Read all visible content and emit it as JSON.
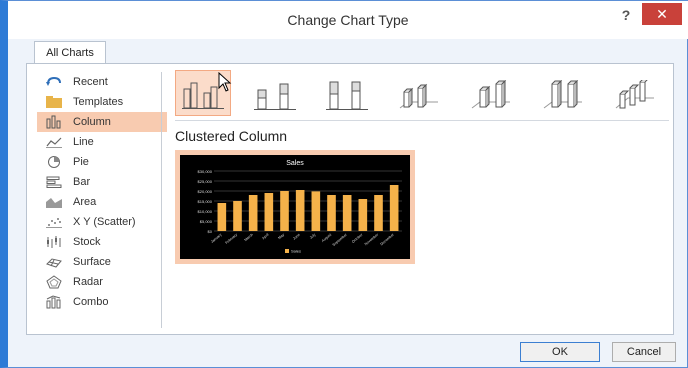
{
  "dialog": {
    "title": "Change Chart Type",
    "help_label": "?",
    "close_label": "✕"
  },
  "tabs": [
    {
      "label": "All Charts",
      "selected": true
    }
  ],
  "sidebar": {
    "items": [
      {
        "label": "Recent",
        "icon": "recent-icon"
      },
      {
        "label": "Templates",
        "icon": "folder-icon"
      },
      {
        "label": "Column",
        "icon": "column-chart-icon",
        "selected": true
      },
      {
        "label": "Line",
        "icon": "line-chart-icon"
      },
      {
        "label": "Pie",
        "icon": "pie-chart-icon"
      },
      {
        "label": "Bar",
        "icon": "bar-chart-icon"
      },
      {
        "label": "Area",
        "icon": "area-chart-icon"
      },
      {
        "label": "X Y (Scatter)",
        "icon": "scatter-chart-icon"
      },
      {
        "label": "Stock",
        "icon": "stock-chart-icon"
      },
      {
        "label": "Surface",
        "icon": "surface-chart-icon"
      },
      {
        "label": "Radar",
        "icon": "radar-chart-icon"
      },
      {
        "label": "Combo",
        "icon": "combo-chart-icon"
      }
    ]
  },
  "subtypes": [
    {
      "name": "clustered-column",
      "selected": true
    },
    {
      "name": "stacked-column",
      "selected": false
    },
    {
      "name": "100-stacked-column",
      "selected": false
    },
    {
      "name": "3d-clustered-column",
      "selected": false
    },
    {
      "name": "3d-stacked-column",
      "selected": false
    },
    {
      "name": "3d-100-stacked-column",
      "selected": false
    },
    {
      "name": "3d-column",
      "selected": false
    }
  ],
  "preview": {
    "label": "Clustered Column"
  },
  "chart_data": {
    "type": "bar",
    "title": "Sales",
    "categories": [
      "January",
      "February",
      "March",
      "April",
      "May",
      "June",
      "July",
      "August",
      "September",
      "October",
      "November",
      "December"
    ],
    "series": [
      {
        "name": "Sales",
        "values": [
          14000,
          15000,
          18000,
          19000,
          20000,
          20500,
          19800,
          18000,
          18000,
          16000,
          18000,
          23000
        ]
      }
    ],
    "ylim": [
      0,
      30000
    ],
    "yticks": [
      "$0",
      "$5,000",
      "$10,000",
      "$15,000",
      "$20,000",
      "$25,000",
      "$30,000"
    ],
    "bar_color": "#f5b24a",
    "background": "#000000",
    "legend_position": "bottom"
  },
  "buttons": {
    "ok_label": "OK",
    "cancel_label": "Cancel"
  },
  "colors": {
    "selection": "#f8cbb0",
    "close_button": "#c9413a",
    "accent_border": "#2e7bd6"
  }
}
